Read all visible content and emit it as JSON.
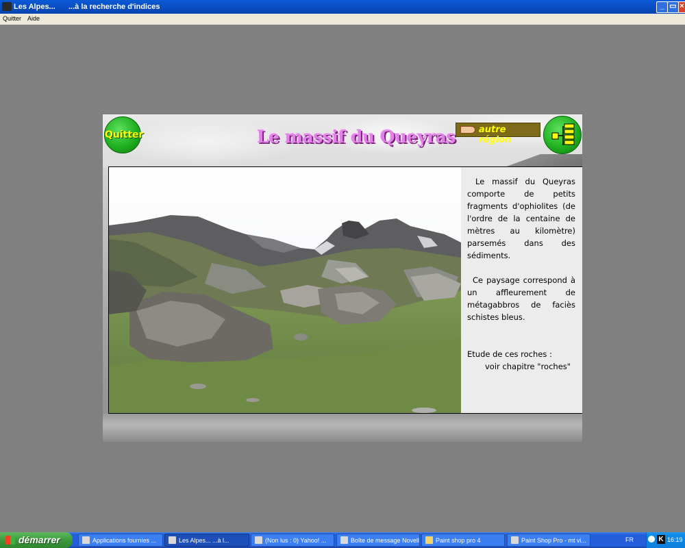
{
  "window": {
    "title_app": "Les Alpes...",
    "title_sub": "...à la recherche d'indices",
    "minimize": "_",
    "restore": "▭",
    "close": "×"
  },
  "menu": [
    "Quitter",
    "Aide"
  ],
  "app": {
    "quit_button": "Quitter",
    "title": "Le massif du Queyras",
    "other_region": "autre région",
    "paragraph1": "Le massif du Queyras comporte de petits fragments d'ophiolites (de l'ordre de la centaine de mètres au kilomètre) parsemés dans des sédiments.",
    "paragraph2": "Ce paysage correspond à un affleurement de métagabbros de faciès schistes bleus.",
    "paragraph3": "Etude de ces roches :",
    "paragraph4": "voir chapitre \"roches\""
  },
  "taskbar": {
    "start": "démarrer",
    "tasks": [
      "Applications fournies ...",
      "Les Alpes...     ...à l...",
      "(Non lus : 0) Yahoo! ...",
      "Boîte de message Novell",
      "Paint shop pro 4",
      "Paint Shop Pro - mt vi..."
    ],
    "lang": "FR",
    "clock": "16:19"
  }
}
